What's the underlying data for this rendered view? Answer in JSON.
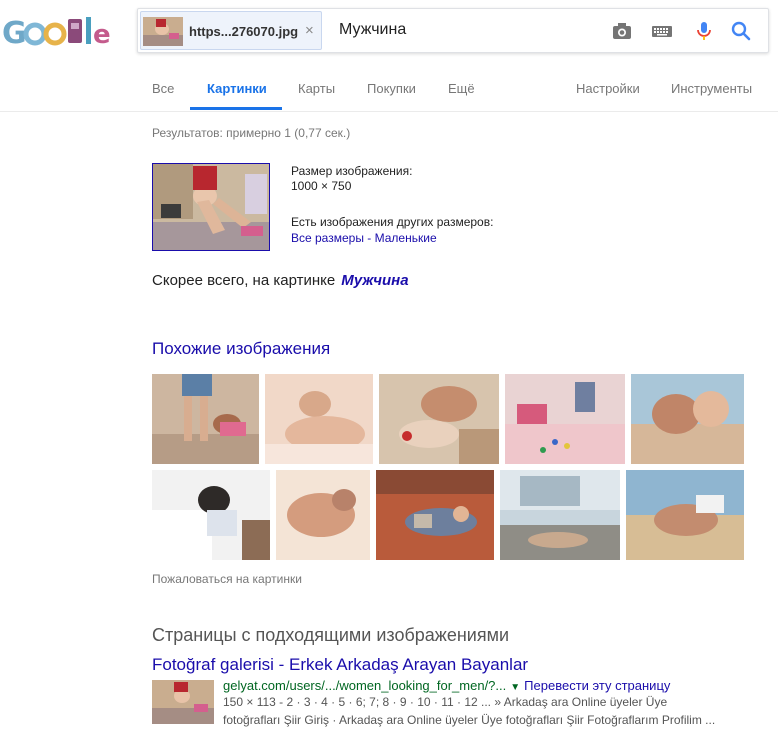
{
  "search": {
    "chip_label": "https...276070.jpg",
    "close_glyph": "×",
    "query": "Мужчина"
  },
  "tabs": [
    {
      "label": "Все"
    },
    {
      "label": "Картинки",
      "active": true
    },
    {
      "label": "Карты"
    },
    {
      "label": "Покупки"
    },
    {
      "label": "Ещё"
    },
    {
      "label": "Настройки"
    },
    {
      "label": "Инструменты"
    }
  ],
  "stats": "Результатов: примерно 1 (0,77 сек.)",
  "image_info": {
    "size_label": "Размер изображения:",
    "size_value": "1000 × 750",
    "other_sizes_label": "Есть изображения других размеров:",
    "all_sizes": "Все размеры",
    "separator": " - ",
    "small": "Маленькие"
  },
  "guess": {
    "prefix": "Скорее всего, на картинке",
    "link": "Мужчина"
  },
  "similar": {
    "title": "Похожие изображения",
    "report": "Пожаловаться на картинки"
  },
  "pages": {
    "title": "Страницы с подходящими изображениями",
    "result": {
      "title": "Fotoğraf galerisi - Erkek Arkadaş Arayan Bayanlar",
      "url": "gelyat.com/users/.../women_looking_for_men/?...",
      "dropdown": "▼",
      "translate": "Перевести эту страницу",
      "snippet1": "150 × 113 - 2 · 3 · 4 · 5 · 6; 7; 8 · 9 · 10 · 11 · 12 ... » Arkadaş ara Online üyeler Üye",
      "snippet2": "fotoğrafları Şiir Giriş · Arkadaş ara Online üyeler Üye fotoğrafları Şiir Fotoğraflarım Profilim ..."
    }
  },
  "colors": {
    "accent": "#1a73e8",
    "link": "#1a0dab",
    "url_green": "#006621"
  },
  "icons": [
    "google-doodle-logo",
    "camera-icon",
    "keyboard-icon",
    "mic-icon",
    "search-icon",
    "close-icon"
  ]
}
